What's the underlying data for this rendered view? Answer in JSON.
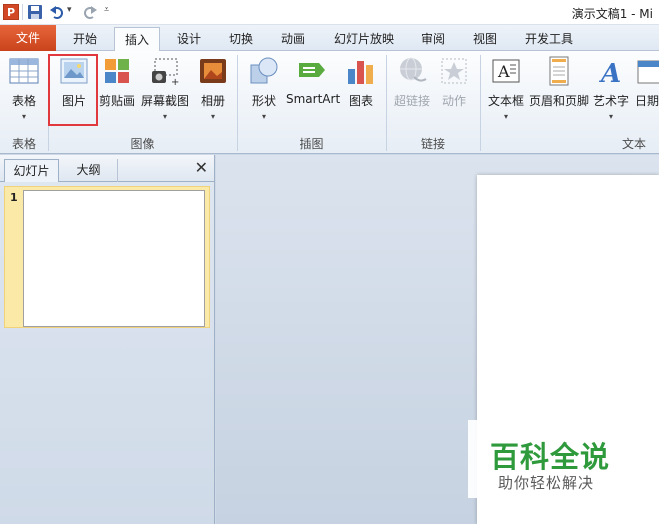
{
  "window": {
    "title": "演示文稿1 - Mi"
  },
  "qat": {
    "app_icon_text": "P"
  },
  "tabs": [
    "文件",
    "开始",
    "插入",
    "设计",
    "切换",
    "动画",
    "幻灯片放映",
    "审阅",
    "视图",
    "开发工具"
  ],
  "ribbon": {
    "buttons": {
      "table": "表格",
      "picture": "图片",
      "clipart": "剪贴画",
      "screenshot": "屏幕截图",
      "album": "相册",
      "shapes": "形状",
      "smartart": "SmartArt",
      "chart": "图表",
      "hyperlink": "超链接",
      "action": "动作",
      "textbox": "文本框",
      "header_footer": "页眉和页脚",
      "wordart": "艺术字",
      "datetime": "日期"
    },
    "groups": {
      "tables": "表格",
      "images": "图像",
      "illustrations": "插图",
      "links": "链接",
      "text": "文本"
    }
  },
  "panel": {
    "tab_slides": "幻灯片",
    "tab_outline": "大纲",
    "close": "✕",
    "slide_number": "1"
  },
  "watermark": {
    "title": "百科全说",
    "subtitle": "助你轻松解决"
  },
  "colors": {
    "file_tab": "#d24726",
    "highlight": "#e0383d",
    "watermark_green": "#2f9a3c"
  }
}
